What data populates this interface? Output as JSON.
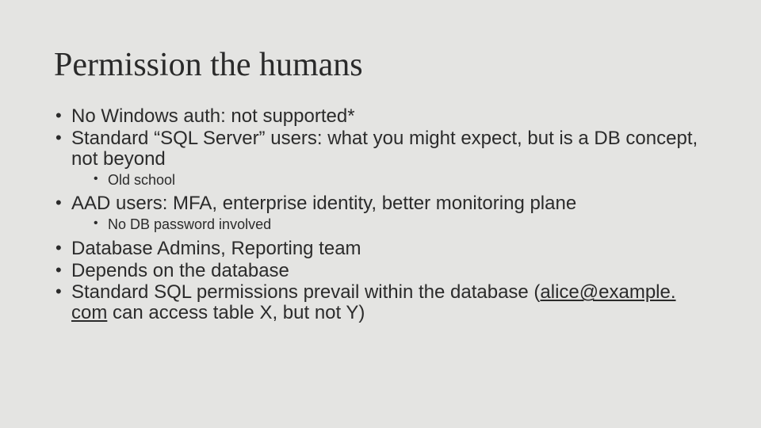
{
  "title": "Permission the humans",
  "bullets": {
    "b1": "No Windows auth: not supported*",
    "b2": "Standard “SQL Server” users: what you might expect, but is a DB concept, not beyond",
    "b2_sub1": "Old school",
    "b3": "AAD users: MFA, enterprise identity, better monitoring plane",
    "b3_sub1": "No DB password involved",
    "b4": "Database Admins, Reporting team",
    "b5": "Depends on the database",
    "b6_pre": "Standard SQL permissions prevail within the database (",
    "b6_email": "alice@example. com",
    "b6_post": " can access table X, but not Y)"
  }
}
